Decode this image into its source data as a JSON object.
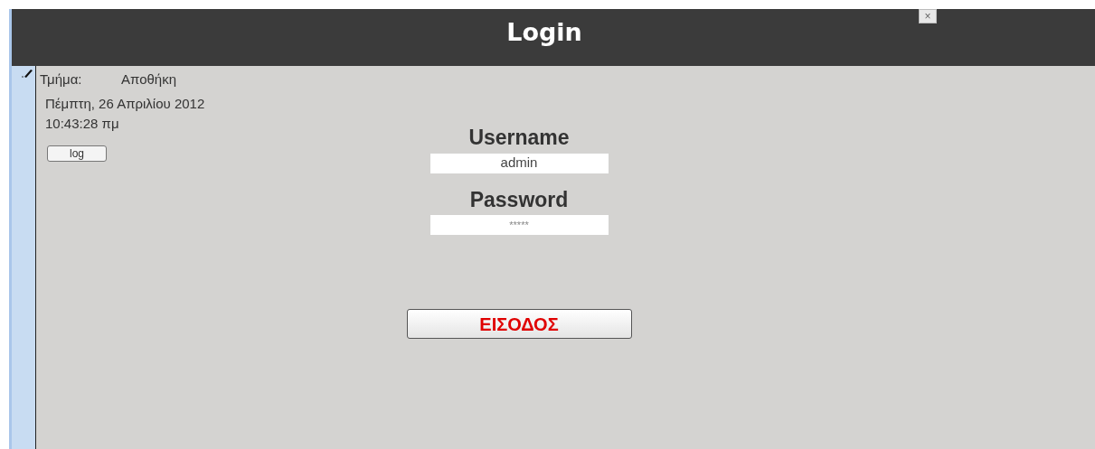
{
  "window": {
    "title": "Login",
    "close": "×"
  },
  "info": {
    "department_label": "Τμήμα:",
    "department_value": "Αποθήκη",
    "date": "Πέμπτη, 26 Απριλίου 2012",
    "time": "10:43:28 πμ",
    "log_button": "log"
  },
  "form": {
    "username_label": "Username",
    "username_value": "admin",
    "password_label": "Password",
    "password_value": "*****",
    "submit": "ΕΙΣΟΔΟΣ"
  }
}
